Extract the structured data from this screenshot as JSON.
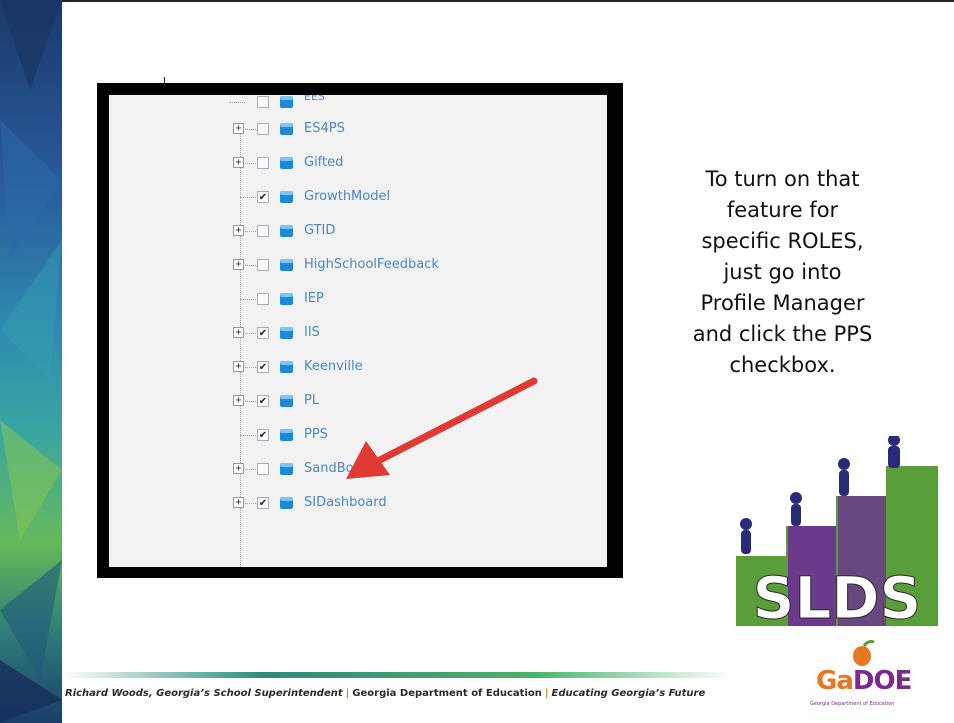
{
  "tree": {
    "items": [
      {
        "label": "ES4PS",
        "checked": false,
        "expandable": true
      },
      {
        "label": "Gifted",
        "checked": false,
        "expandable": true
      },
      {
        "label": "GrowthModel",
        "checked": true,
        "expandable": false
      },
      {
        "label": "GTID",
        "checked": false,
        "expandable": true
      },
      {
        "label": "HighSchoolFeedback",
        "checked": false,
        "expandable": true
      },
      {
        "label": "IEP",
        "checked": false,
        "expandable": false
      },
      {
        "label": "IIS",
        "checked": true,
        "expandable": true
      },
      {
        "label": "Keenville",
        "checked": true,
        "expandable": true
      },
      {
        "label": "PL",
        "checked": true,
        "expandable": true
      },
      {
        "label": "PPS",
        "checked": true,
        "expandable": false
      },
      {
        "label": "SandBox",
        "checked": false,
        "expandable": true
      },
      {
        "label": "SIDashboard",
        "checked": true,
        "expandable": true
      }
    ],
    "partial_top_label": "EES"
  },
  "explanation": {
    "lines": [
      "To turn on that",
      "feature for",
      "specific ROLES,",
      "just go into",
      "Profile Manager",
      "and click the PPS",
      "checkbox."
    ]
  },
  "logos": {
    "slds_text": "SLDS",
    "gadoe_prefix": "Ga",
    "gadoe_suffix": "DOE",
    "gadoe_sub": "Georgia Department of Education"
  },
  "footer": {
    "superintendent": "Richard Woods, Georgia’s School Superintendent",
    "separator": "|",
    "department": "Georgia Department of Education",
    "motto": "Educating Georgia’s Future"
  },
  "colors": {
    "link_blue": "#4a87c7",
    "arrow_red": "#e03a32",
    "slds_green": "#5a9e3a",
    "slds_purple": "#6b3a8c",
    "footer_orange": "#e87722"
  },
  "icons": {
    "tree_node": "cube-icon",
    "arrow": "red-arrow-icon"
  }
}
